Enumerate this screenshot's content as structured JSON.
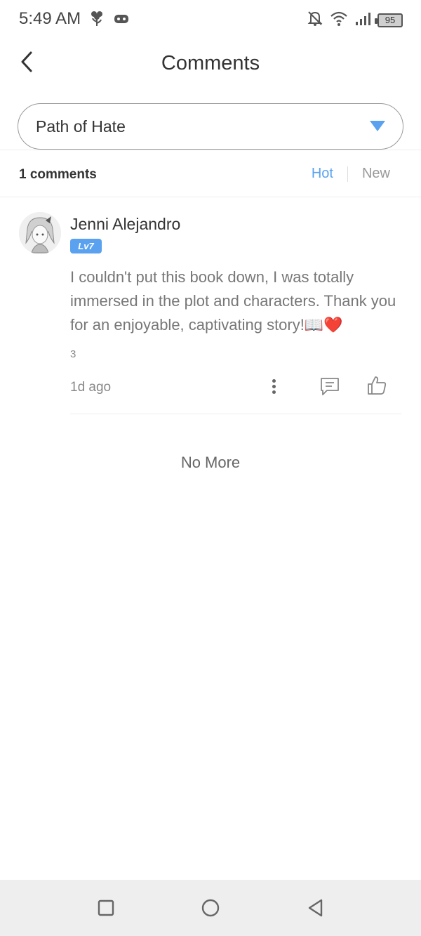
{
  "status_bar": {
    "time": "5:49 AM",
    "battery": "95",
    "icons": [
      "flower-icon",
      "gamepad-icon",
      "bell-off-icon",
      "wifi-icon",
      "signal-icon",
      "battery-icon"
    ]
  },
  "header": {
    "title": "Comments",
    "back_icon": "chevron-left-icon"
  },
  "book_selector": {
    "selected": "Path of Hate",
    "icon": "triangle-down-icon"
  },
  "comments_bar": {
    "count_label": "1 comments",
    "sort_options": [
      "Hot",
      "New"
    ],
    "active_sort": "Hot"
  },
  "comments": [
    {
      "author": "Jenni Alejandro",
      "level": "Lv7",
      "text": "I couldn't put this book down, I was totally immersed in the plot and characters. Thank you for an enjoyable, captivating story!📖❤️",
      "extra": "3",
      "time": "1d ago",
      "actions": [
        "more-icon",
        "reply-icon",
        "like-icon"
      ]
    }
  ],
  "footer": {
    "no_more": "No More"
  },
  "colors": {
    "accent": "#5aa2ef",
    "text_primary": "#333333",
    "text_secondary": "#777777",
    "nav_bar_bg": "#eeeeee"
  },
  "nav_bar": {
    "buttons": [
      "recent-apps-icon",
      "home-icon",
      "back-triangle-icon"
    ]
  }
}
